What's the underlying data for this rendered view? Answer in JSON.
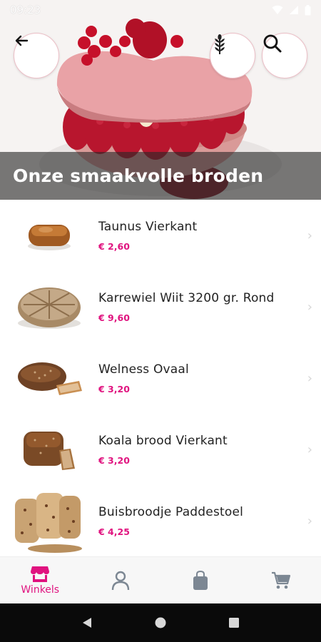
{
  "status_bar": {
    "time": "09:23"
  },
  "hero": {
    "title": "Onze smaakvolle broden"
  },
  "products": [
    {
      "name": "Taunus Vierkant",
      "price": "€ 2,60"
    },
    {
      "name": "Karrewiel Wiit 3200 gr. Rond",
      "price": "€ 9,60"
    },
    {
      "name": "Welness Ovaal",
      "price": "€ 3,20"
    },
    {
      "name": "Koala brood Vierkant",
      "price": "€ 3,20"
    },
    {
      "name": "Buisbroodje Paddestoel",
      "price": "€ 4,25"
    }
  ],
  "bottom_nav": {
    "items": [
      {
        "label": "Winkels",
        "icon": "store-icon",
        "active": true
      },
      {
        "label": "",
        "icon": "user-icon",
        "active": false
      },
      {
        "label": "",
        "icon": "bag-icon",
        "active": false
      },
      {
        "label": "",
        "icon": "cart-icon",
        "active": false
      }
    ]
  },
  "colors": {
    "accent": "#e0137f",
    "inactive_icon": "#7c8793",
    "button_border": "#ecbfc7"
  }
}
